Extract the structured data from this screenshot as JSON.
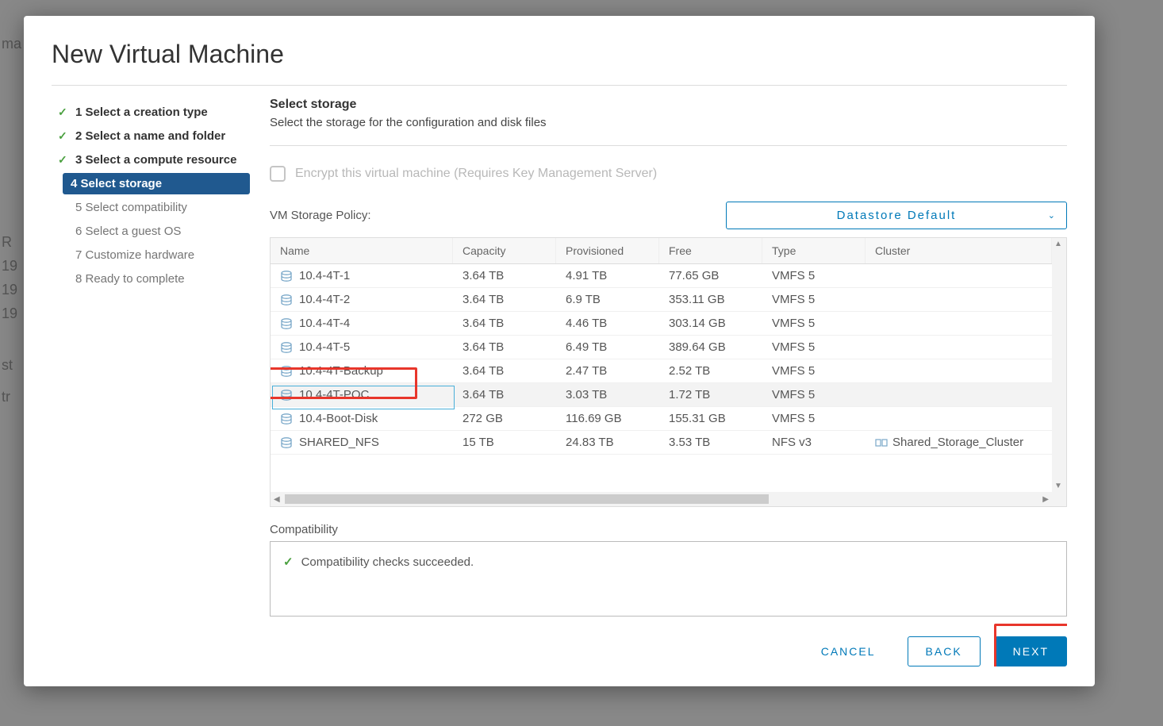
{
  "page_title": "New Virtual Machine",
  "steps": [
    {
      "label": "1 Select a creation type",
      "state": "done"
    },
    {
      "label": "2 Select a name and folder",
      "state": "done"
    },
    {
      "label": "3 Select a compute resource",
      "state": "done"
    },
    {
      "label": "4 Select storage",
      "state": "active"
    },
    {
      "label": "5 Select compatibility",
      "state": "pending"
    },
    {
      "label": "6 Select a guest OS",
      "state": "pending"
    },
    {
      "label": "7 Customize hardware",
      "state": "pending"
    },
    {
      "label": "8 Ready to complete",
      "state": "pending"
    }
  ],
  "content": {
    "heading": "Select storage",
    "subheading": "Select the storage for the configuration and disk files",
    "encrypt_label": "Encrypt this virtual machine (Requires Key Management Server)",
    "policy_label": "VM Storage Policy:",
    "policy_value": "Datastore Default",
    "columns": {
      "name": "Name",
      "capacity": "Capacity",
      "provisioned": "Provisioned",
      "free": "Free",
      "type": "Type",
      "cluster": "Cluster"
    },
    "rows": [
      {
        "name": "10.4-4T-1",
        "capacity": "3.64 TB",
        "provisioned": "4.91 TB",
        "free": "77.65 GB",
        "type": "VMFS 5",
        "cluster": ""
      },
      {
        "name": "10.4-4T-2",
        "capacity": "3.64 TB",
        "provisioned": "6.9 TB",
        "free": "353.11 GB",
        "type": "VMFS 5",
        "cluster": ""
      },
      {
        "name": "10.4-4T-4",
        "capacity": "3.64 TB",
        "provisioned": "4.46 TB",
        "free": "303.14 GB",
        "type": "VMFS 5",
        "cluster": ""
      },
      {
        "name": "10.4-4T-5",
        "capacity": "3.64 TB",
        "provisioned": "6.49 TB",
        "free": "389.64 GB",
        "type": "VMFS 5",
        "cluster": ""
      },
      {
        "name": "10.4-4T-Backup",
        "capacity": "3.64 TB",
        "provisioned": "2.47 TB",
        "free": "2.52 TB",
        "type": "VMFS 5",
        "cluster": ""
      },
      {
        "name": "10.4-4T-POC",
        "capacity": "3.64 TB",
        "provisioned": "3.03 TB",
        "free": "1.72 TB",
        "type": "VMFS 5",
        "cluster": "",
        "selected": true
      },
      {
        "name": "10.4-Boot-Disk",
        "capacity": "272 GB",
        "provisioned": "116.69 GB",
        "free": "155.31 GB",
        "type": "VMFS 5",
        "cluster": ""
      },
      {
        "name": "SHARED_NFS",
        "capacity": "15 TB",
        "provisioned": "24.83 TB",
        "free": "3.53 TB",
        "type": "NFS v3",
        "cluster": "Shared_Storage_Cluster"
      }
    ],
    "compat_label": "Compatibility",
    "compat_msg": "Compatibility checks succeeded."
  },
  "footer": {
    "cancel": "CANCEL",
    "back": "BACK",
    "next": "NEXT"
  },
  "bg": {
    "frag1": "ma",
    "frag2": "R",
    "frag3": "19",
    "frag4": "19",
    "frag5": "19",
    "frag6": "st",
    "frag7": "tr"
  }
}
